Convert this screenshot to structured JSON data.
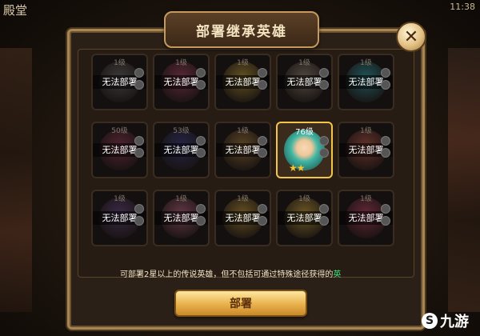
{
  "background": {
    "hall_title": "殿堂",
    "clock": "11:38"
  },
  "dialog": {
    "title": "部署继承英雄",
    "close_label": "✕",
    "info_text": "可部署2星以上的传说英雄，但不包括可通过特殊途径获得的",
    "info_tail": "英",
    "deploy_label": "部署"
  },
  "heroes": [
    {
      "level": "1级",
      "status": "无法部署",
      "tint": "#6d6d6d"
    },
    {
      "level": "1级",
      "status": "无法部署",
      "tint": "#b2456a"
    },
    {
      "level": "1级",
      "status": "无法部署",
      "tint": "#c9a63a"
    },
    {
      "level": "1级",
      "status": "无法部署",
      "tint": "#9a8a7a"
    },
    {
      "level": "1级",
      "status": "无法部署",
      "tint": "#2fa6b0"
    },
    {
      "level": "50级",
      "status": "无法部署",
      "tint": "#9a3a5a"
    },
    {
      "level": "53级",
      "status": "无法部署",
      "tint": "#3a3f8a"
    },
    {
      "level": "1级",
      "status": "无法部署",
      "tint": "#b08040"
    },
    {
      "level": "76级",
      "status": "",
      "tint": "#2c9f90",
      "stars": "★★"
    },
    {
      "level": "1级",
      "status": "无法部署",
      "tint": "#c45a4a"
    },
    {
      "level": "1级",
      "status": "无法部署",
      "tint": "#6a4a8a"
    },
    {
      "level": "1级",
      "status": "无法部署",
      "tint": "#c46a8a"
    },
    {
      "level": "1级",
      "status": "无法部署",
      "tint": "#c9a03a"
    },
    {
      "level": "1级",
      "status": "无法部署",
      "tint": "#d8b040"
    },
    {
      "level": "1级",
      "status": "无法部署",
      "tint": "#c4456a"
    }
  ],
  "watermark": {
    "symbol": "S",
    "text": "九游"
  }
}
